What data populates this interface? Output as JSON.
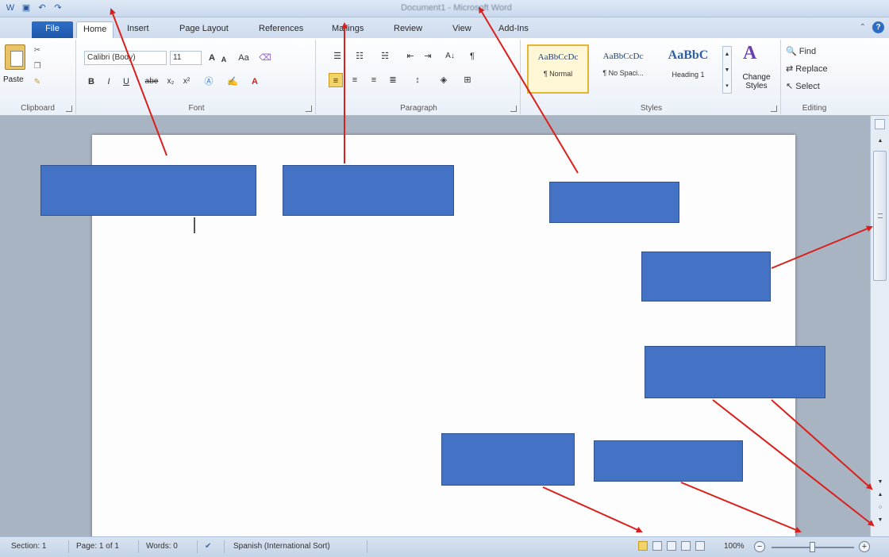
{
  "qat": {
    "icons": [
      "word-icon",
      "save-icon",
      "undo-icon",
      "redo-icon"
    ]
  },
  "title_bar": {
    "title": "Document1 - Microsoft Word"
  },
  "tabs": [
    {
      "label": "File"
    },
    {
      "label": "Home"
    },
    {
      "label": "Insert"
    },
    {
      "label": "Page Layout"
    },
    {
      "label": "References"
    },
    {
      "label": "Mailings"
    },
    {
      "label": "Review"
    },
    {
      "label": "View"
    },
    {
      "label": "Add-Ins"
    }
  ],
  "ribbon": {
    "clipboard": {
      "paste": "Paste",
      "label": "Clipboard"
    },
    "font": {
      "font_name": "Calibri (Body)",
      "font_size": "11",
      "grow": "A",
      "shrink": "A",
      "case": "Aa",
      "bold": "B",
      "italic": "I",
      "underline": "U",
      "strike": "abe",
      "sub": "x₂",
      "sup": "x²",
      "label": "Font"
    },
    "paragraph": {
      "label": "Paragraph",
      "sort": "A↓"
    },
    "styles": {
      "items": [
        {
          "sample": "AaBbCcDc",
          "name": "¶ Normal"
        },
        {
          "sample": "AaBbCcDc",
          "name": "¶ No Spaci..."
        },
        {
          "sample": "AaBbC",
          "name": "Heading 1"
        }
      ],
      "change_styles": "Change Styles",
      "label": "Styles"
    },
    "editing": {
      "find": "Find",
      "replace": "Replace",
      "select": "Select",
      "label": "Editing"
    }
  },
  "status_bar": {
    "section": "Section: 1",
    "page": "Page: 1 of 1",
    "words": "Words: 0",
    "language": "Spanish (International Sort)",
    "zoom": "100%"
  },
  "colors": {
    "callout": "#4472c4",
    "arrow": "#d9201c",
    "file_tab": "#2b6cc4"
  }
}
